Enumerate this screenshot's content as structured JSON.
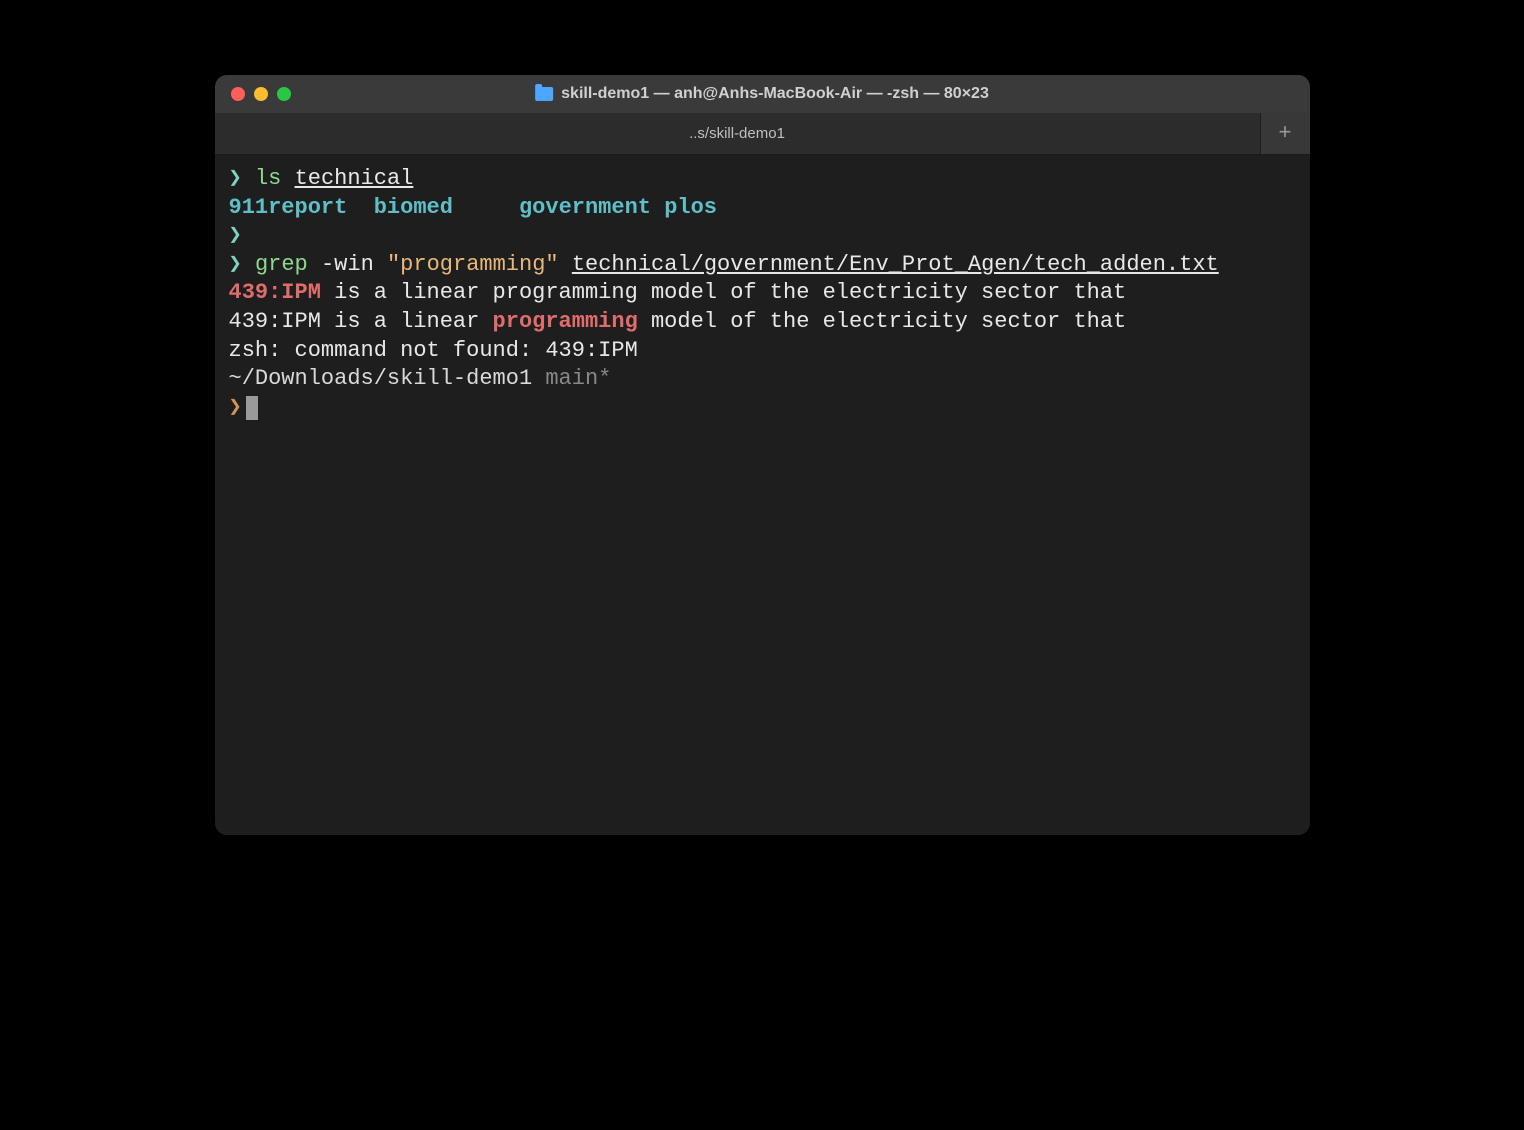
{
  "titlebar": {
    "title": "skill-demo1 — anh@Anhs-MacBook-Air — -zsh — 80×23"
  },
  "tab": {
    "label": "..s/skill-demo1",
    "add_tab_label": "+"
  },
  "terminal": {
    "lines": {
      "l1_prompt": "❯",
      "l1_cmd": "ls",
      "l1_arg": "technical",
      "l2_dir1": "911report",
      "l2_dir2": "biomed",
      "l2_dir3": "government",
      "l2_dir4": "plos",
      "l3_prompt": "❯",
      "l4_prompt": "❯",
      "l4_cmd": "grep",
      "l4_flags": "-win",
      "l4_quoted": "\"programming\"",
      "l4_path": "technical/government/Env_Prot_Agen/tech_adden.txt",
      "l5_hl": "439:IPM",
      "l5_rest": " is a linear programming model of the electricity sector that",
      "l6_pre": "439:IPM is a linear ",
      "l6_hl": "programming",
      "l6_post": " model of the electricity sector that",
      "l7": "zsh: command not found: 439:IPM",
      "l8_path": "~/Downloads/skill-demo1",
      "l8_branch": "main*",
      "l9_prompt": "❯"
    }
  }
}
